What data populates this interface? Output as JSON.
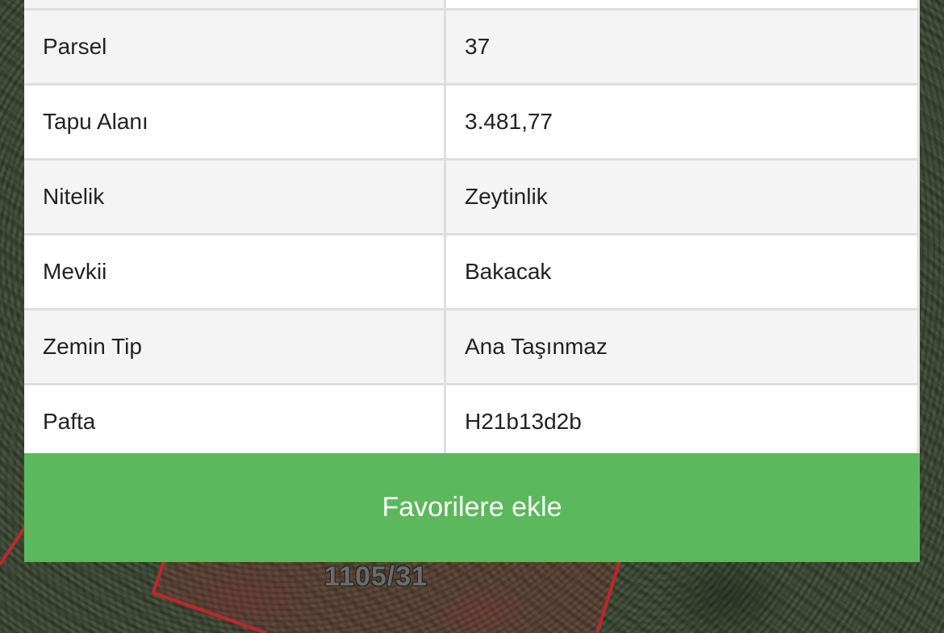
{
  "map": {
    "parcel_label": "1105/31",
    "parcel_outline_color": "#c0272d"
  },
  "table": {
    "rows": [
      {
        "key": "Parsel",
        "value": "37"
      },
      {
        "key": "Tapu Alanı",
        "value": "3.481,77"
      },
      {
        "key": "Nitelik",
        "value": "Zeytinlik"
      },
      {
        "key": "Mevkii",
        "value": "Bakacak"
      },
      {
        "key": "Zemin Tip",
        "value": "Ana Taşınmaz"
      },
      {
        "key": "Pafta",
        "value": "H21b13d2b"
      }
    ]
  },
  "actions": {
    "favorite_label": "Favorilere ekle",
    "favorite_color": "#5cb85c"
  }
}
